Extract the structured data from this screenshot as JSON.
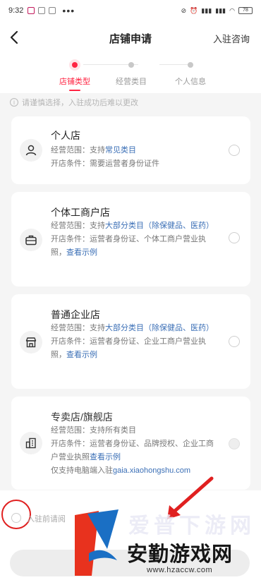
{
  "status_bar": {
    "time": "9:32",
    "battery": "78"
  },
  "header": {
    "title": "店铺申请",
    "consult": "入驻咨询"
  },
  "steps": [
    {
      "label": "店铺类型",
      "active": true
    },
    {
      "label": "经营类目",
      "active": false
    },
    {
      "label": "个人信息",
      "active": false
    }
  ],
  "notice": "请谨慎选择，入驻成功后难以更改",
  "cards": [
    {
      "name": "个人店",
      "scope_prefix": "经营范围：支持",
      "scope_highlight": "常见类目",
      "cond": "开店条件：需要运营者身份证件"
    },
    {
      "name": "个体工商户店",
      "scope_prefix": "经营范围：支持",
      "scope_highlight": "大部分类目（除保健品、医药）",
      "cond": "开店条件：运营者身份证、个体工商户营业执照，",
      "cond_link": "查看示例"
    },
    {
      "name": "普通企业店",
      "scope_prefix": "经营范围：支持",
      "scope_highlight": "大部分类目（除保健品、医药）",
      "cond": "开店条件：运营者身份证、企业工商户营业执照，",
      "cond_link": "查看示例"
    },
    {
      "name": "专卖店/旗舰店",
      "scope_prefix": "经营范围：支持所有类目",
      "cond": "开店条件：运营者身份证、品牌授权、企业工商户营业执照",
      "cond_link": "查看示例",
      "pc_prefix": "仅支持电脑端入驻",
      "pc_link": "gaia.xiaohongshu.com"
    }
  ],
  "agreement": {
    "text": "入驻前请阅"
  },
  "watermark": {
    "line1": "爱普下游网",
    "line2": "安勤游戏网",
    "line3": "www.hzaccw.com"
  },
  "colors": {
    "accent": "#ff2442",
    "link": "#3b6fb6",
    "annotation": "#e02020"
  },
  "icons": {
    "back": "arrow-left",
    "card1": "user",
    "card2": "briefcase",
    "card3": "shop",
    "card4": "building"
  }
}
